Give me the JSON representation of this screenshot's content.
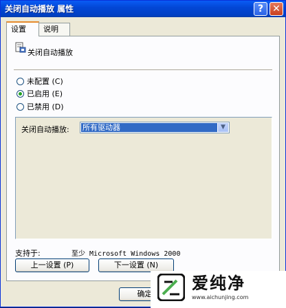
{
  "window": {
    "title": "关闭自动播放 属性",
    "help_label": "?",
    "close_label": "✕"
  },
  "tabs": [
    {
      "label": "设置"
    },
    {
      "label": "说明"
    }
  ],
  "policy": {
    "icon": "policy-setting-icon",
    "title": "关闭自动播放"
  },
  "options": {
    "not_configured": "未配置 (C)",
    "enabled": "已启用 (E)",
    "disabled": "已禁用 (D)",
    "selected": "enabled"
  },
  "setting": {
    "label": "关闭自动播放:",
    "value": "所有驱动器"
  },
  "supported": {
    "label": "支持于:",
    "value": "至少 Microsoft Windows 2000"
  },
  "buttons": {
    "prev": "上一设置 (P)",
    "next": "下一设置 (N)",
    "ok": "确定"
  },
  "watermark": {
    "name": "爱纯净",
    "url": "www.aichunjing.com"
  }
}
